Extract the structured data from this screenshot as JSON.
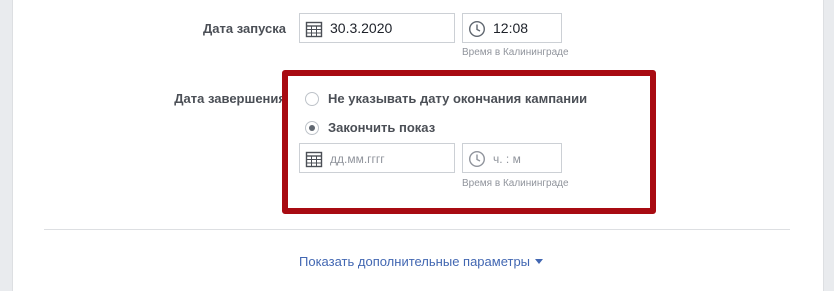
{
  "start": {
    "label": "Дата запуска",
    "date_value": "30.3.2020",
    "time_value": "12:08",
    "timezone_note": "Время в Калининграде"
  },
  "end": {
    "label": "Дата завершения",
    "option_no_end": "Не указывать дату окончания кампании",
    "option_end": "Закончить показ",
    "selected_option": "option_end",
    "date_placeholder": "дд.мм.гггг",
    "time_placeholder": "ч. : м",
    "timezone_note": "Время в Калининграде"
  },
  "more_params_link": "Показать дополнительные параметры",
  "icons": {
    "date": "calendar-icon",
    "time": "clock-icon",
    "dropdown": "caret-down-icon"
  },
  "colors": {
    "highlight_border": "#a80b12",
    "link": "#4267b2",
    "label": "#4b4f56"
  }
}
